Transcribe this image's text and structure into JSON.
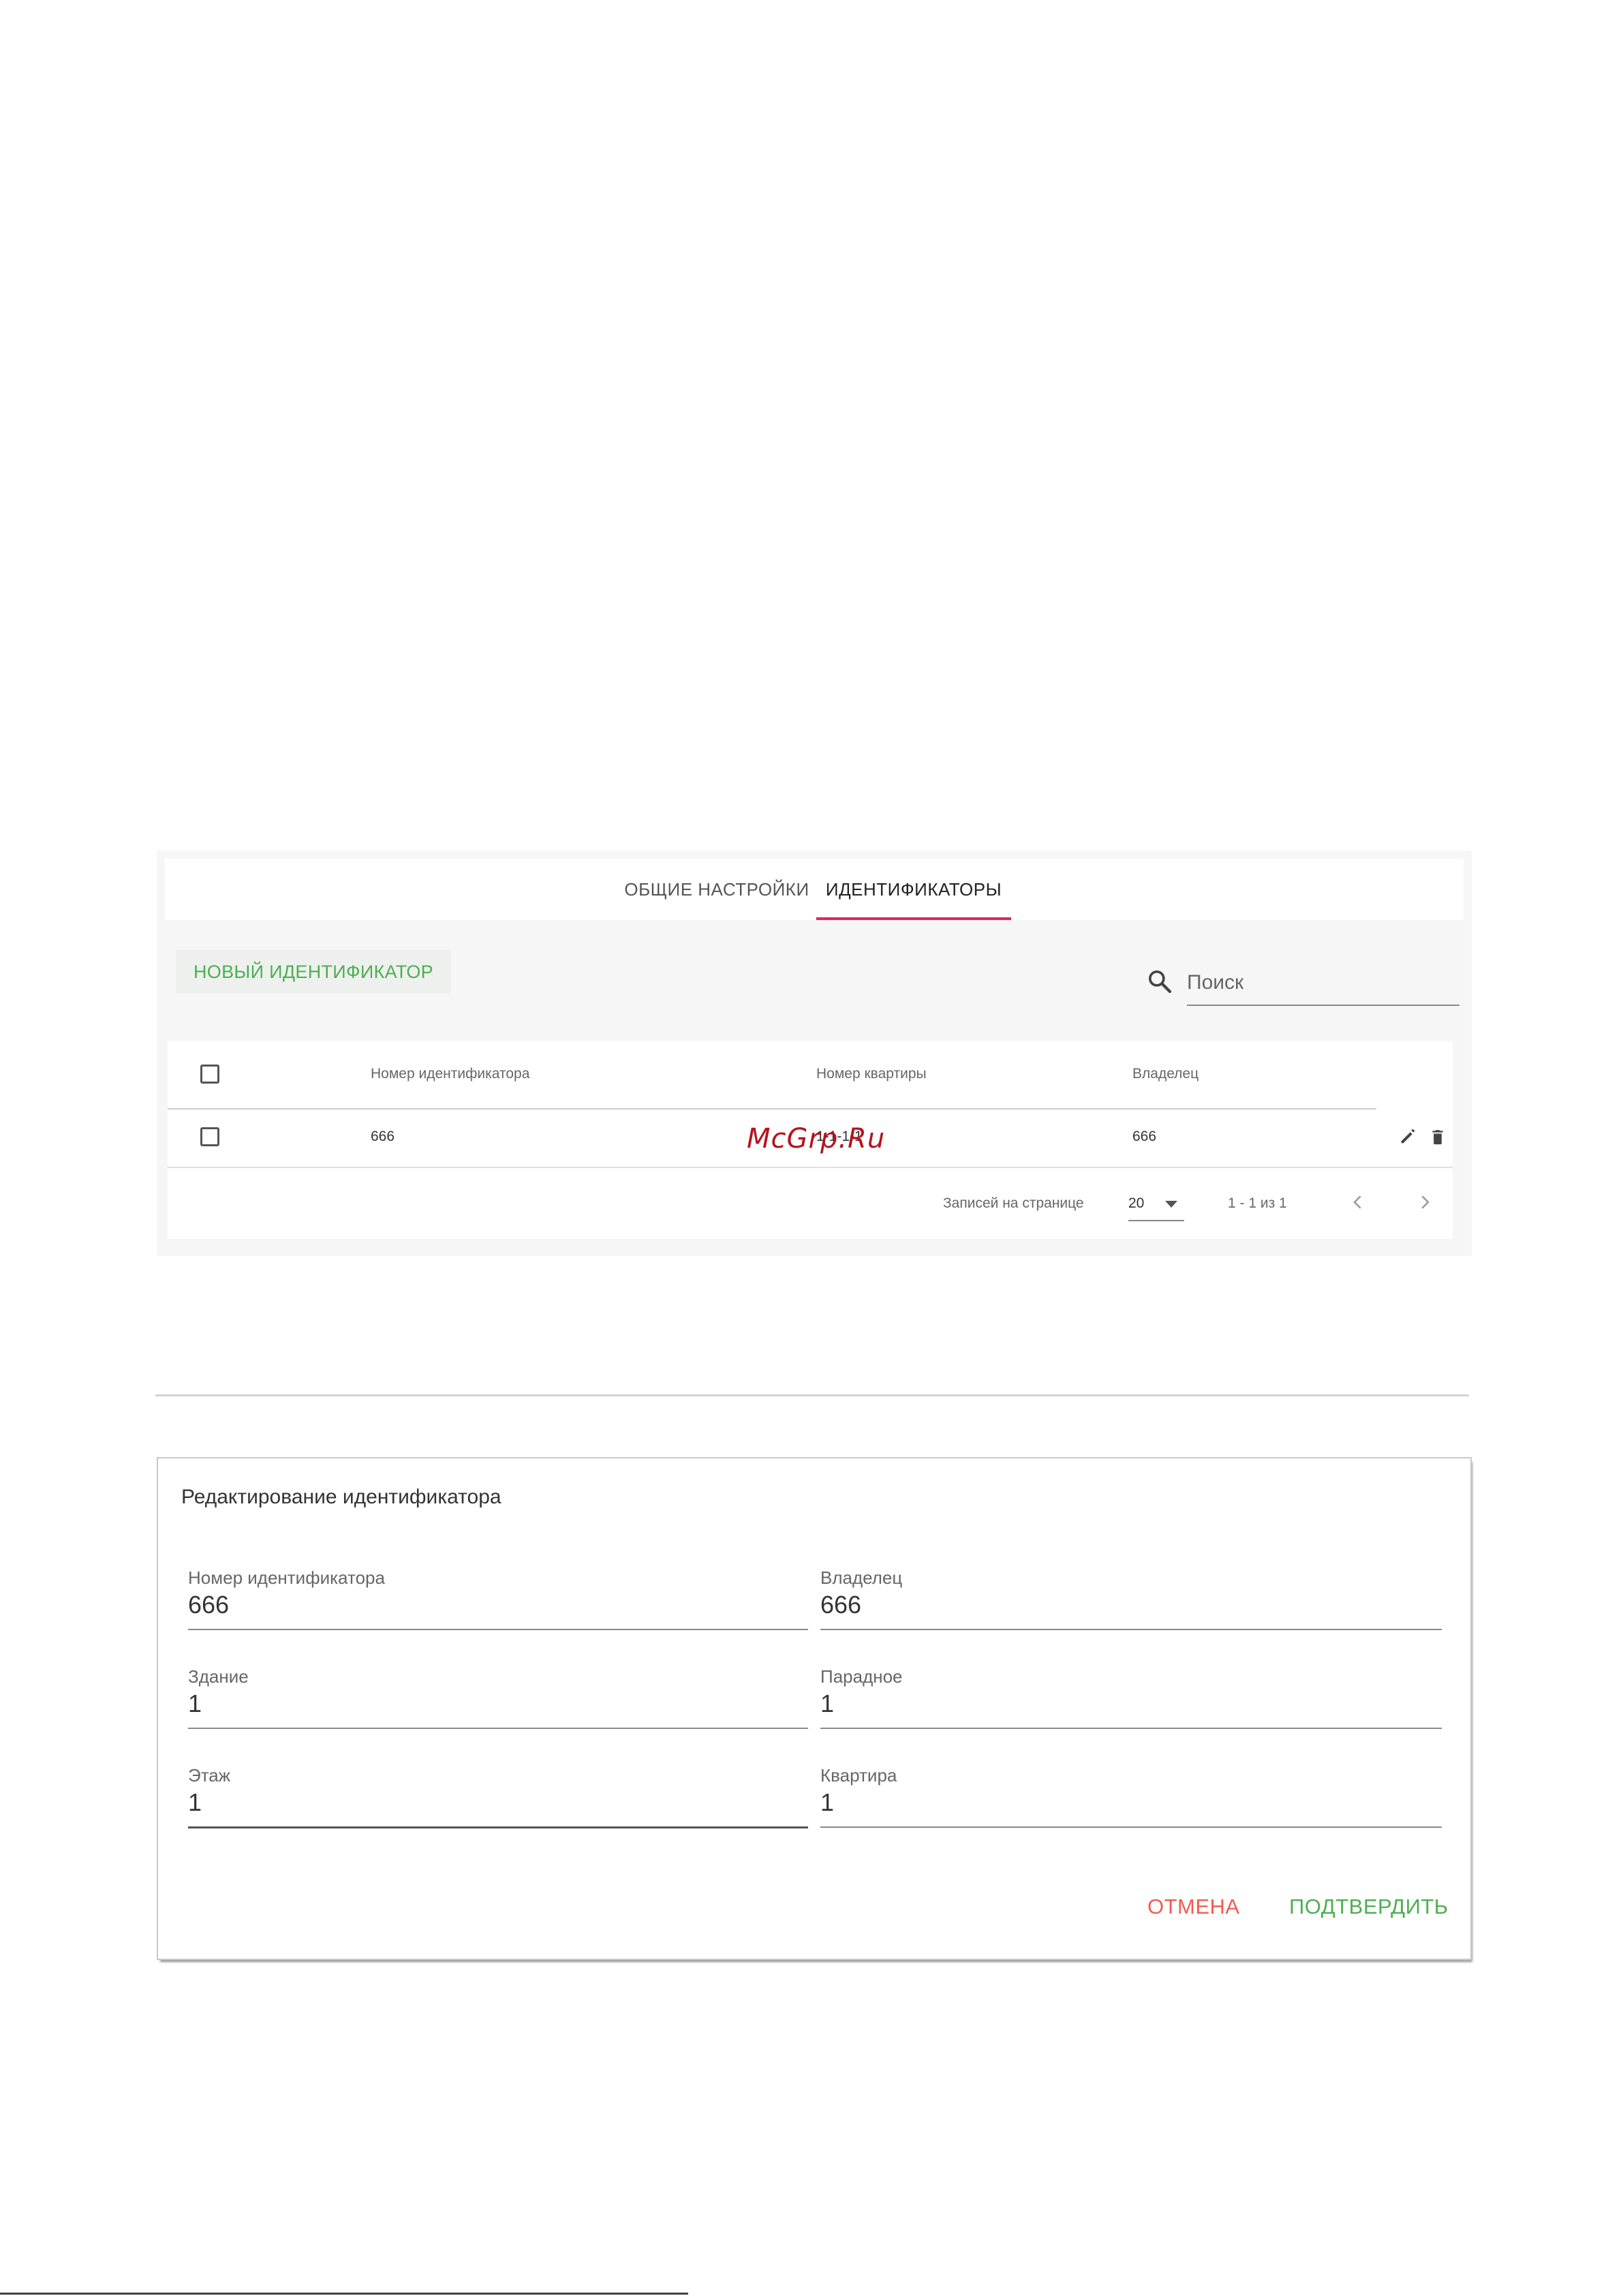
{
  "tabs": {
    "general": "ОБЩИЕ НАСТРОЙКИ",
    "identifiers": "ИДЕНТИФИКАТОРЫ"
  },
  "toolbar": {
    "new_button": "НОВЫЙ ИДЕНТИФИКАТОР",
    "search_placeholder": "Поиск"
  },
  "table": {
    "columns": {
      "id_number": "Номер идентификатора",
      "apartment": "Номер квартиры",
      "owner": "Владелец"
    },
    "rows": [
      {
        "id_number": "666",
        "apartment": "1-1-1-1",
        "owner": "666"
      }
    ],
    "watermark": "McGrp.Ru",
    "pagination": {
      "per_page_label": "Записей на странице",
      "per_page_value": "20",
      "range": "1 - 1 из 1"
    }
  },
  "dialog": {
    "title": "Редактирование идентификатора",
    "fields": {
      "id_number": {
        "label": "Номер идентификатора",
        "value": "666"
      },
      "owner": {
        "label": "Владелец",
        "value": "666"
      },
      "building": {
        "label": "Здание",
        "value": "1"
      },
      "entrance": {
        "label": "Парадное",
        "value": "1"
      },
      "floor": {
        "label": "Этаж",
        "value": "1"
      },
      "apartment": {
        "label": "Квартира",
        "value": "1"
      }
    },
    "cancel": "ОТМЕНА",
    "confirm": "ПОДТВЕРДИТЬ"
  },
  "colors": {
    "accent_tab": "#e91e63",
    "primary_green": "#4caf50",
    "cancel_red": "#f45b4f"
  }
}
